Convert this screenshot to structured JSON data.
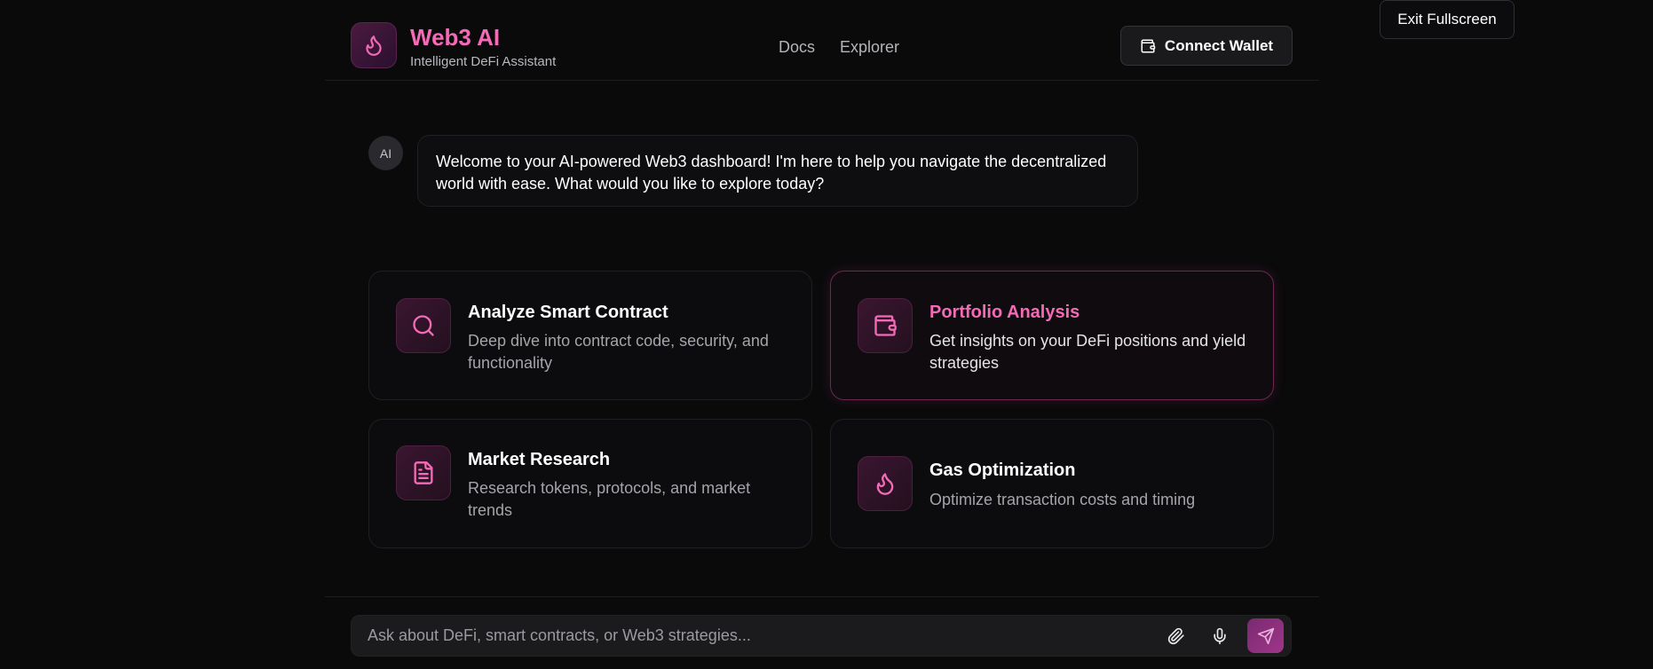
{
  "exit_fullscreen_label": "Exit Fullscreen",
  "header": {
    "brand_title": "Web3 AI",
    "brand_subtitle": "Intelligent DeFi Assistant",
    "nav": [
      {
        "label": "Docs"
      },
      {
        "label": "Explorer"
      }
    ],
    "connect_wallet_label": "Connect Wallet"
  },
  "chat": {
    "ai_avatar_label": "AI",
    "welcome_message": "Welcome to your AI-powered Web3 dashboard! I'm here to help you navigate the decentralized world with ease. What would you like to explore today?"
  },
  "cards": [
    {
      "title": "Analyze Smart Contract",
      "description": "Deep dive into contract code, security, and functionality",
      "icon": "search-icon"
    },
    {
      "title": "Portfolio Analysis",
      "description": "Get insights on your DeFi positions and yield strategies",
      "icon": "wallet-icon"
    },
    {
      "title": "Market Research",
      "description": "Research tokens, protocols, and market trends",
      "icon": "document-icon"
    },
    {
      "title": "Gas Optimization",
      "description": "Optimize transaction costs and timing",
      "icon": "flame-icon"
    }
  ],
  "input": {
    "placeholder": "Ask about DeFi, smart contracts, or Web3 strategies..."
  },
  "colors": {
    "accent": "#f36bb7",
    "background": "#0a0a0b"
  }
}
